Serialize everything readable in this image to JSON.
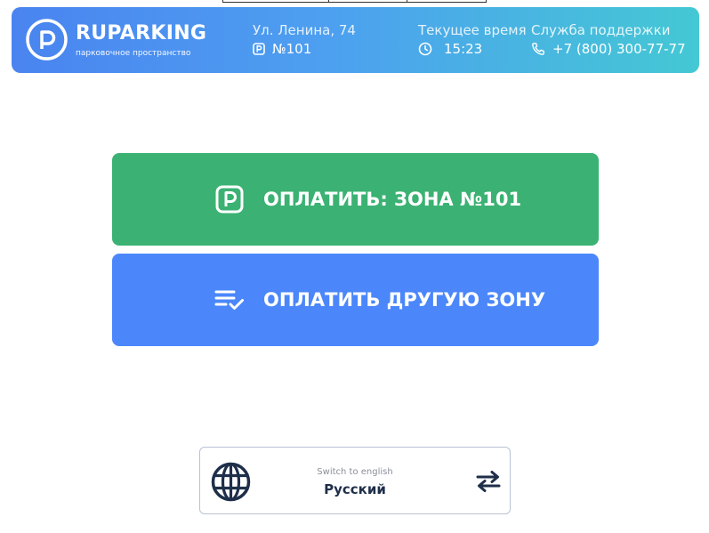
{
  "brand": {
    "name": "RUPARKING",
    "tagline": "парковочное пространство"
  },
  "location": {
    "address": "Ул. Ленина, 74",
    "zone": "№101"
  },
  "time": {
    "label": "Текущее время",
    "value": "15:23"
  },
  "support": {
    "label": "Служба поддержки",
    "phone": "+7 (800) 300-77-77"
  },
  "actions": {
    "pay_current_zone": "ОПЛАТИТЬ: ЗОНА №101",
    "pay_other_zone": "ОПЛАТИТЬ ДРУГУЮ ЗОНУ"
  },
  "language": {
    "hint": "Switch to english",
    "current": "Русский"
  },
  "colors": {
    "pay_current_bg": "#3bb273",
    "pay_other_bg": "#4b87fb",
    "header_gradient_start": "#4a84f0",
    "header_gradient_end": "#44c8d4",
    "dark_text": "#1f2f4a"
  },
  "icons": [
    "parking-logo-icon",
    "parking-icon",
    "clock-icon",
    "phone-icon",
    "parking-square-icon",
    "list-check-icon",
    "globe-icon",
    "swap-arrows-icon"
  ]
}
